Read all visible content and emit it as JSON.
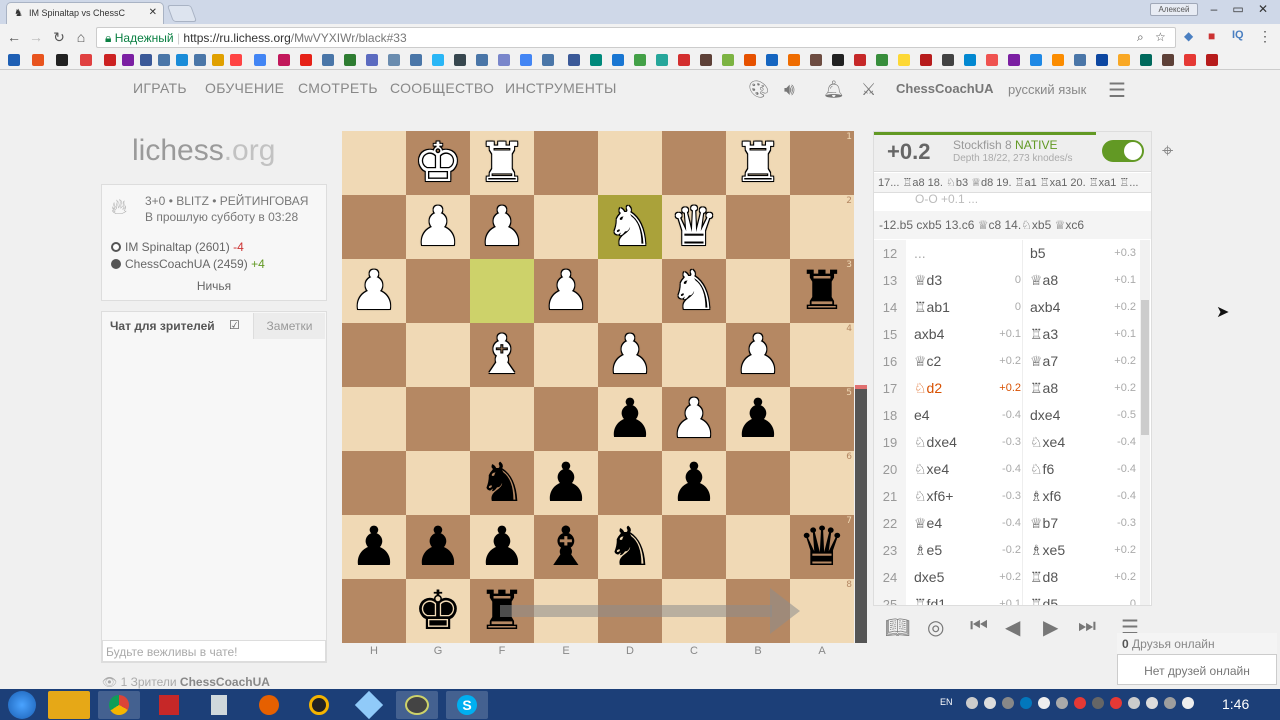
{
  "browser": {
    "tab_title": "IM Spinaltap vs ChessC",
    "profile": "Алексей",
    "url_secure": "Надежный",
    "url_domain": "https://ru.lichess.org",
    "url_path": "/MwVYXIWr/black#33"
  },
  "nav": {
    "items": [
      "ИГРАТЬ",
      "ОБУЧЕНИЕ",
      "СМОТРЕТЬ",
      "СООБЩЕСТВО",
      "ИНСТРУМЕНТЫ"
    ],
    "username": "ChessCoachUA",
    "language": "русский язык"
  },
  "logo": {
    "main": "lichess",
    "tld": ".org"
  },
  "game": {
    "type": "3+0 • BLITZ • РЕЙТИНГОВАЯ",
    "date": "В прошлую субботу в 03:28",
    "white_player": "IM Spinaltap (2601)",
    "white_diff": "-4",
    "black_player": "ChessCoachUA (2459)",
    "black_diff": "+4",
    "result": "Ничья"
  },
  "chat": {
    "tab": "Чат для зрителей",
    "notes_tab": "Заметки",
    "placeholder": "Будьте вежливы в чате!",
    "watchers_count": "1 Зрители",
    "watchers_name": "ChessCoachUA"
  },
  "board": {
    "files": [
      "H",
      "G",
      "F",
      "E",
      "D",
      "C",
      "B",
      "A"
    ],
    "ranks": [
      "1",
      "2",
      "3",
      "4",
      "5",
      "6",
      "7",
      "8"
    ],
    "pieces": [
      [
        "",
        "wK",
        "wR",
        "",
        "",
        "",
        "wR",
        ""
      ],
      [
        "",
        "wP",
        "wP",
        "",
        "wN",
        "wQ",
        "",
        ""
      ],
      [
        "wP",
        "",
        "",
        "wP",
        "",
        "wN",
        "",
        "bR"
      ],
      [
        "",
        "",
        "wB",
        "",
        "wP",
        "",
        "wP",
        ""
      ],
      [
        "",
        "",
        "",
        "",
        "bP",
        "wP",
        "bP",
        ""
      ],
      [
        "",
        "",
        "bN",
        "bP",
        "",
        "bP",
        "",
        ""
      ],
      [
        "bP",
        "bP",
        "bP",
        "bB",
        "bN",
        "",
        "",
        "bQ"
      ],
      [
        "",
        "bK",
        "bR",
        "",
        "",
        "",
        "",
        ""
      ]
    ],
    "highlights": [
      [
        2,
        2
      ],
      [
        1,
        4
      ]
    ]
  },
  "analysis": {
    "eval": "+0.2",
    "engine": "Stockfish 8",
    "engine_tag": "NATIVE",
    "depth": "Depth 18/22, 273 knodes/s",
    "pv": "17... ♖a8 18. ♘b3 ♕d8 19. ♖a1 ♖xa1 20. ♖xa1 ♖... ",
    "pv_prev": "O-O              +0.1     ...",
    "variation": "-12.b5 cxb5 13.c6 ♕c8 14.♘xb5 ♕xc6",
    "moves": [
      {
        "n": "12",
        "w": "...",
        "we": "",
        "b": "b5",
        "be": "+0.3"
      },
      {
        "n": "13",
        "w": "♕d3",
        "we": "0",
        "b": "♕a8",
        "be": "+0.1"
      },
      {
        "n": "14",
        "w": "♖ab1",
        "we": "0",
        "b": "axb4",
        "be": "+0.2"
      },
      {
        "n": "15",
        "w": "axb4",
        "we": "+0.1",
        "b": "♖a3",
        "be": "+0.1"
      },
      {
        "n": "16",
        "w": "♕c2",
        "we": "+0.2",
        "b": "♕a7",
        "be": "+0.2"
      },
      {
        "n": "17",
        "w": "♘d2",
        "we": "+0.2",
        "b": "♖a8",
        "be": "+0.2"
      },
      {
        "n": "18",
        "w": "e4",
        "we": "-0.4",
        "b": "dxe4",
        "be": "-0.5"
      },
      {
        "n": "19",
        "w": "♘dxe4",
        "we": "-0.3",
        "b": "♘xe4",
        "be": "-0.4"
      },
      {
        "n": "20",
        "w": "♘xe4",
        "we": "-0.4",
        "b": "♘f6",
        "be": "-0.4"
      },
      {
        "n": "21",
        "w": "♘xf6+",
        "we": "-0.3",
        "b": "♗xf6",
        "be": "-0.4"
      },
      {
        "n": "22",
        "w": "♕e4",
        "we": "-0.4",
        "b": "♕b7",
        "be": "-0.3"
      },
      {
        "n": "23",
        "w": "♗e5",
        "we": "-0.2",
        "b": "♗xe5",
        "be": "+0.2"
      },
      {
        "n": "24",
        "w": "dxe5",
        "we": "+0.2",
        "b": "♖d8",
        "be": "+0.2"
      },
      {
        "n": "25",
        "w": "♖fd1",
        "we": "+0.1",
        "b": "♖d5",
        "be": "0"
      }
    ]
  },
  "friends": {
    "header_count": "0",
    "header": "Друзья онлайн",
    "empty": "Нет друзей онлайн"
  },
  "taskbar": {
    "lang": "EN",
    "time": "1:46"
  }
}
